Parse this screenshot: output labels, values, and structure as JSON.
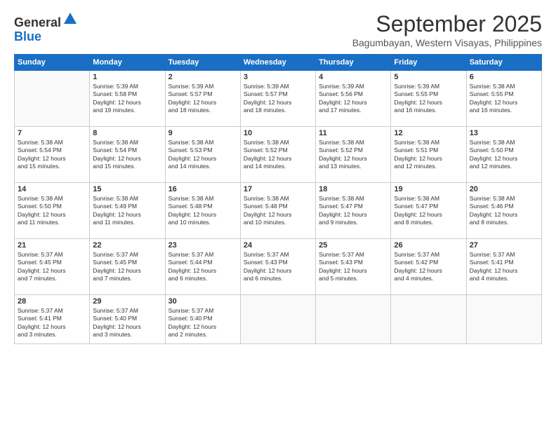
{
  "logo": {
    "general": "General",
    "blue": "Blue"
  },
  "title": "September 2025",
  "location": "Bagumbayan, Western Visayas, Philippines",
  "headers": [
    "Sunday",
    "Monday",
    "Tuesday",
    "Wednesday",
    "Thursday",
    "Friday",
    "Saturday"
  ],
  "weeks": [
    [
      {
        "num": "",
        "info": ""
      },
      {
        "num": "1",
        "info": "Sunrise: 5:39 AM\nSunset: 5:58 PM\nDaylight: 12 hours\nand 19 minutes."
      },
      {
        "num": "2",
        "info": "Sunrise: 5:39 AM\nSunset: 5:57 PM\nDaylight: 12 hours\nand 18 minutes."
      },
      {
        "num": "3",
        "info": "Sunrise: 5:39 AM\nSunset: 5:57 PM\nDaylight: 12 hours\nand 18 minutes."
      },
      {
        "num": "4",
        "info": "Sunrise: 5:39 AM\nSunset: 5:56 PM\nDaylight: 12 hours\nand 17 minutes."
      },
      {
        "num": "5",
        "info": "Sunrise: 5:39 AM\nSunset: 5:55 PM\nDaylight: 12 hours\nand 16 minutes."
      },
      {
        "num": "6",
        "info": "Sunrise: 5:38 AM\nSunset: 5:55 PM\nDaylight: 12 hours\nand 16 minutes."
      }
    ],
    [
      {
        "num": "7",
        "info": "Sunrise: 5:38 AM\nSunset: 5:54 PM\nDaylight: 12 hours\nand 15 minutes."
      },
      {
        "num": "8",
        "info": "Sunrise: 5:38 AM\nSunset: 5:54 PM\nDaylight: 12 hours\nand 15 minutes."
      },
      {
        "num": "9",
        "info": "Sunrise: 5:38 AM\nSunset: 5:53 PM\nDaylight: 12 hours\nand 14 minutes."
      },
      {
        "num": "10",
        "info": "Sunrise: 5:38 AM\nSunset: 5:52 PM\nDaylight: 12 hours\nand 14 minutes."
      },
      {
        "num": "11",
        "info": "Sunrise: 5:38 AM\nSunset: 5:52 PM\nDaylight: 12 hours\nand 13 minutes."
      },
      {
        "num": "12",
        "info": "Sunrise: 5:38 AM\nSunset: 5:51 PM\nDaylight: 12 hours\nand 12 minutes."
      },
      {
        "num": "13",
        "info": "Sunrise: 5:38 AM\nSunset: 5:50 PM\nDaylight: 12 hours\nand 12 minutes."
      }
    ],
    [
      {
        "num": "14",
        "info": "Sunrise: 5:38 AM\nSunset: 5:50 PM\nDaylight: 12 hours\nand 11 minutes."
      },
      {
        "num": "15",
        "info": "Sunrise: 5:38 AM\nSunset: 5:49 PM\nDaylight: 12 hours\nand 11 minutes."
      },
      {
        "num": "16",
        "info": "Sunrise: 5:38 AM\nSunset: 5:48 PM\nDaylight: 12 hours\nand 10 minutes."
      },
      {
        "num": "17",
        "info": "Sunrise: 5:38 AM\nSunset: 5:48 PM\nDaylight: 12 hours\nand 10 minutes."
      },
      {
        "num": "18",
        "info": "Sunrise: 5:38 AM\nSunset: 5:47 PM\nDaylight: 12 hours\nand 9 minutes."
      },
      {
        "num": "19",
        "info": "Sunrise: 5:38 AM\nSunset: 5:47 PM\nDaylight: 12 hours\nand 8 minutes."
      },
      {
        "num": "20",
        "info": "Sunrise: 5:38 AM\nSunset: 5:46 PM\nDaylight: 12 hours\nand 8 minutes."
      }
    ],
    [
      {
        "num": "21",
        "info": "Sunrise: 5:37 AM\nSunset: 5:45 PM\nDaylight: 12 hours\nand 7 minutes."
      },
      {
        "num": "22",
        "info": "Sunrise: 5:37 AM\nSunset: 5:45 PM\nDaylight: 12 hours\nand 7 minutes."
      },
      {
        "num": "23",
        "info": "Sunrise: 5:37 AM\nSunset: 5:44 PM\nDaylight: 12 hours\nand 6 minutes."
      },
      {
        "num": "24",
        "info": "Sunrise: 5:37 AM\nSunset: 5:43 PM\nDaylight: 12 hours\nand 6 minutes."
      },
      {
        "num": "25",
        "info": "Sunrise: 5:37 AM\nSunset: 5:43 PM\nDaylight: 12 hours\nand 5 minutes."
      },
      {
        "num": "26",
        "info": "Sunrise: 5:37 AM\nSunset: 5:42 PM\nDaylight: 12 hours\nand 4 minutes."
      },
      {
        "num": "27",
        "info": "Sunrise: 5:37 AM\nSunset: 5:41 PM\nDaylight: 12 hours\nand 4 minutes."
      }
    ],
    [
      {
        "num": "28",
        "info": "Sunrise: 5:37 AM\nSunset: 5:41 PM\nDaylight: 12 hours\nand 3 minutes."
      },
      {
        "num": "29",
        "info": "Sunrise: 5:37 AM\nSunset: 5:40 PM\nDaylight: 12 hours\nand 3 minutes."
      },
      {
        "num": "30",
        "info": "Sunrise: 5:37 AM\nSunset: 5:40 PM\nDaylight: 12 hours\nand 2 minutes."
      },
      {
        "num": "",
        "info": ""
      },
      {
        "num": "",
        "info": ""
      },
      {
        "num": "",
        "info": ""
      },
      {
        "num": "",
        "info": ""
      }
    ]
  ]
}
